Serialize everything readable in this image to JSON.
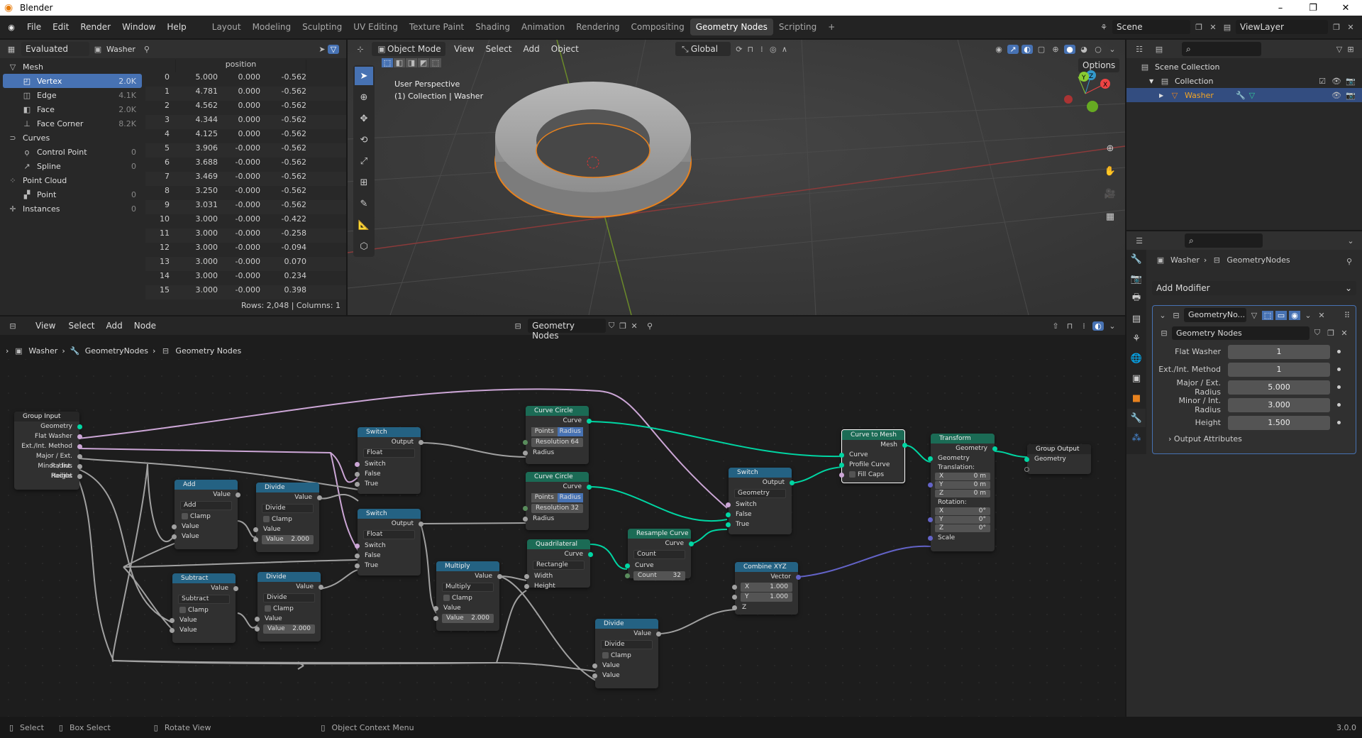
{
  "window": {
    "title": "Blender",
    "controls": [
      "–",
      "❐",
      "✕"
    ]
  },
  "menu": [
    "File",
    "Edit",
    "Render",
    "Window",
    "Help"
  ],
  "workspaces": [
    {
      "label": "Layout",
      "active": false
    },
    {
      "label": "Modeling",
      "active": false
    },
    {
      "label": "Sculpting",
      "active": false
    },
    {
      "label": "UV Editing",
      "active": false
    },
    {
      "label": "Texture Paint",
      "active": false
    },
    {
      "label": "Shading",
      "active": false
    },
    {
      "label": "Animation",
      "active": false
    },
    {
      "label": "Rendering",
      "active": false
    },
    {
      "label": "Compositing",
      "active": false
    },
    {
      "label": "Geometry Nodes",
      "active": true
    },
    {
      "label": "Scripting",
      "active": false
    }
  ],
  "add_workspace": "+",
  "scene": {
    "name": "Scene",
    "view_layer": "ViewLayer"
  },
  "spreadsheet": {
    "mode": "Evaluated",
    "object": "Washer",
    "domains": [
      {
        "label": "Mesh",
        "level": 0,
        "count": "",
        "icon": "mesh-icon"
      },
      {
        "label": "Vertex",
        "level": 1,
        "count": "2.0K",
        "selected": true,
        "icon": "vertex-icon"
      },
      {
        "label": "Edge",
        "level": 1,
        "count": "4.1K",
        "icon": "edge-icon"
      },
      {
        "label": "Face",
        "level": 1,
        "count": "2.0K",
        "icon": "face-icon"
      },
      {
        "label": "Face Corner",
        "level": 1,
        "count": "8.2K",
        "icon": "face-corner-icon"
      },
      {
        "label": "Curves",
        "level": 0,
        "count": "",
        "icon": "curves-icon"
      },
      {
        "label": "Control Point",
        "level": 1,
        "count": "0",
        "icon": "control-point-icon"
      },
      {
        "label": "Spline",
        "level": 1,
        "count": "0",
        "icon": "spline-icon"
      },
      {
        "label": "Point Cloud",
        "level": 0,
        "count": "",
        "icon": "point-cloud-icon"
      },
      {
        "label": "Point",
        "level": 1,
        "count": "0",
        "icon": "point-icon"
      },
      {
        "label": "Instances",
        "level": 0,
        "count": "0",
        "icon": "instances-icon"
      }
    ],
    "column_header": "position",
    "rows": [
      [
        "0",
        "5.000",
        "0.000",
        "-0.562"
      ],
      [
        "1",
        "4.781",
        "0.000",
        "-0.562"
      ],
      [
        "2",
        "4.562",
        "0.000",
        "-0.562"
      ],
      [
        "3",
        "4.344",
        "0.000",
        "-0.562"
      ],
      [
        "4",
        "4.125",
        "0.000",
        "-0.562"
      ],
      [
        "5",
        "3.906",
        "-0.000",
        "-0.562"
      ],
      [
        "6",
        "3.688",
        "-0.000",
        "-0.562"
      ],
      [
        "7",
        "3.469",
        "-0.000",
        "-0.562"
      ],
      [
        "8",
        "3.250",
        "-0.000",
        "-0.562"
      ],
      [
        "9",
        "3.031",
        "-0.000",
        "-0.562"
      ],
      [
        "10",
        "3.000",
        "-0.000",
        "-0.422"
      ],
      [
        "11",
        "3.000",
        "-0.000",
        "-0.258"
      ],
      [
        "12",
        "3.000",
        "-0.000",
        "-0.094"
      ],
      [
        "13",
        "3.000",
        "-0.000",
        "0.070"
      ],
      [
        "14",
        "3.000",
        "-0.000",
        "0.234"
      ],
      [
        "15",
        "3.000",
        "-0.000",
        "0.398"
      ]
    ],
    "footer": "Rows: 2,048   |   Columns: 1"
  },
  "viewport": {
    "mode": "Object Mode",
    "menus": [
      "View",
      "Select",
      "Add",
      "Object"
    ],
    "orientation": "Global",
    "options": "Options",
    "info_line1": "User Perspective",
    "info_line2": "(1) Collection | Washer",
    "gizmo": {
      "x": "X",
      "y": "Y",
      "z": "Z"
    }
  },
  "outliner": {
    "items": [
      {
        "label": "Scene Collection",
        "level": 0
      },
      {
        "label": "Collection",
        "level": 1
      },
      {
        "label": "Washer",
        "level": 2,
        "selected": true
      }
    ]
  },
  "properties": {
    "breadcrumb": [
      "Washer",
      "GeometryNodes"
    ],
    "add_modifier": "Add Modifier",
    "modifier_name": "GeometryNo...",
    "node_group": "Geometry Nodes",
    "inputs": [
      {
        "label": "Flat Washer",
        "value": "1"
      },
      {
        "label": "Ext./Int. Method",
        "value": "1"
      },
      {
        "label": "Major / Ext. Radius",
        "value": "5.000"
      },
      {
        "label": "Minor / Int. Radius",
        "value": "3.000"
      },
      {
        "label": "Height",
        "value": "1.500"
      }
    ],
    "output_attributes": "Output Attributes"
  },
  "node_editor": {
    "menus": [
      "View",
      "Select",
      "Add",
      "Node"
    ],
    "tree_name": "Geometry Nodes",
    "breadcrumb": [
      "Washer",
      "GeometryNodes",
      "Geometry Nodes"
    ],
    "nodes": {
      "group_input": {
        "title": "Group Input",
        "outputs": [
          "Geometry",
          "Flat Washer",
          "Ext./Int. Method",
          "Major / Ext. Radius",
          "Minor / Int. Radius",
          "Height"
        ]
      },
      "add": {
        "title": "Add",
        "out": "Value",
        "op": "Add",
        "clamp": "Clamp",
        "in1": "Value",
        "in2": "Value"
      },
      "divide1": {
        "title": "Divide",
        "out": "Value",
        "op": "Divide",
        "clamp": "Clamp",
        "in1": "Value",
        "in2_label": "Value",
        "in2_value": "2.000"
      },
      "subtract": {
        "title": "Subtract",
        "out": "Value",
        "op": "Subtract",
        "clamp": "Clamp",
        "in1": "Value",
        "in2": "Value"
      },
      "divide2": {
        "title": "Divide",
        "out": "Value",
        "op": "Divide",
        "clamp": "Clamp",
        "in1": "Value",
        "in2_label": "Value",
        "in2_value": "2.000"
      },
      "switch1": {
        "title": "Switch",
        "out": "Output",
        "type": "Float",
        "in": [
          "Switch",
          "False",
          "True"
        ]
      },
      "switch2": {
        "title": "Switch",
        "out": "Output",
        "type": "Float",
        "in": [
          "Switch",
          "False",
          "True"
        ]
      },
      "multiply": {
        "title": "Multiply",
        "out": "Value",
        "op": "Multiply",
        "clamp": "Clamp",
        "in1": "Value",
        "in2_label": "Value",
        "in2_value": "2.000"
      },
      "curve_circle1": {
        "title": "Curve Circle",
        "out": "Curve",
        "modes": [
          "Points",
          "Radius"
        ],
        "res_label": "Resolution",
        "res": "64",
        "in": "Radius"
      },
      "curve_circle2": {
        "title": "Curve Circle",
        "out": "Curve",
        "modes": [
          "Points",
          "Radius"
        ],
        "res_label": "Resolution",
        "res": "32",
        "in": "Radius"
      },
      "quad": {
        "title": "Quadrilateral",
        "out": "Curve",
        "mode": "Rectangle",
        "in": [
          "Width",
          "Height"
        ]
      },
      "resample": {
        "title": "Resample Curve",
        "out": "Curve",
        "mode": "Count",
        "in": "Curve",
        "count_label": "Count",
        "count": "32"
      },
      "divide3": {
        "title": "Divide",
        "out": "Value",
        "op": "Divide",
        "clamp": "Clamp",
        "in1": "Value",
        "in2": "Value"
      },
      "switch3": {
        "title": "Switch",
        "out": "Output",
        "type": "Geometry",
        "in": [
          "Switch",
          "False",
          "True"
        ]
      },
      "combine": {
        "title": "Combine XYZ",
        "out": "Vector",
        "x": "1.000",
        "y": "1.000",
        "z": "Z"
      },
      "curve_to_mesh": {
        "title": "Curve to Mesh",
        "out": "Mesh",
        "in": [
          "Curve",
          "Profile Curve",
          "Fill Caps"
        ]
      },
      "transform": {
        "title": "Transform",
        "out": "Geometry",
        "in": "Geometry",
        "translation": "Translation:",
        "t": [
          "0 m",
          "0 m",
          "0 m"
        ],
        "rotation": "Rotation:",
        "r": [
          "0°",
          "0°",
          "0°"
        ],
        "scale": "Scale"
      },
      "group_output": {
        "title": "Group Output",
        "in": "Geometry"
      }
    }
  },
  "statusbar": {
    "select": "Select",
    "box_select": "Box Select",
    "rotate": "Rotate View",
    "context": "Object Context Menu",
    "version": "3.0.0"
  }
}
